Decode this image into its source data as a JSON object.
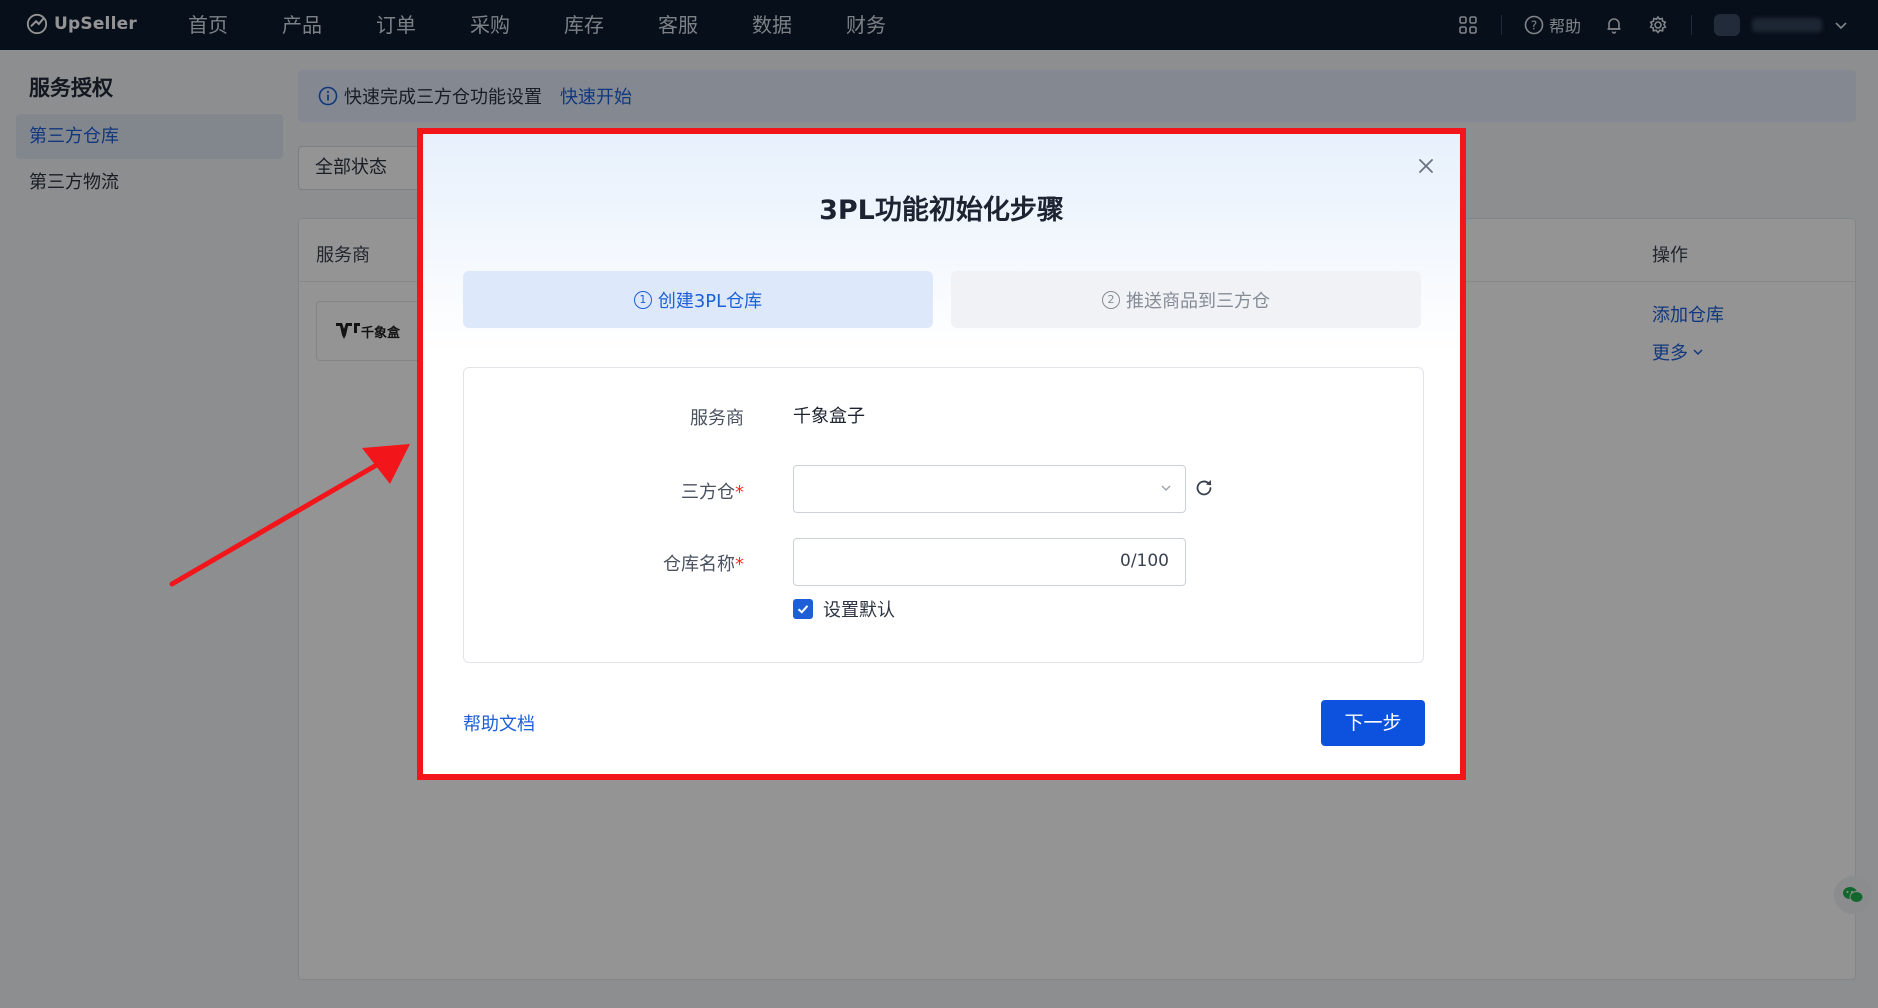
{
  "app": {
    "brand": "UpSeller"
  },
  "nav": {
    "items": [
      "首页",
      "产品",
      "订单",
      "采购",
      "库存",
      "客服",
      "数据",
      "财务"
    ],
    "help_label": "帮助"
  },
  "sidebar": {
    "title": "服务授权",
    "items": [
      {
        "label": "第三方仓库",
        "active": true
      },
      {
        "label": "第三方物流",
        "active": false
      }
    ]
  },
  "banner": {
    "text": "快速完成三方仓功能设置",
    "link": "快速开始"
  },
  "filter": {
    "status_value": "全部状态"
  },
  "table": {
    "headers": {
      "provider": "服务商",
      "operations": "操作"
    },
    "row": {
      "provider_logo_text": "千象盒",
      "add_link": "添加仓库",
      "more_link": "更多"
    }
  },
  "modal": {
    "title": "3PL功能初始化步骤",
    "steps": [
      {
        "num": "1",
        "label": "创建3PL仓库",
        "active": true
      },
      {
        "num": "2",
        "label": "推送商品到三方仓",
        "active": false
      }
    ],
    "form": {
      "provider_label": "服务商",
      "provider_value": "千象盒子",
      "warehouse_label": "三方仓",
      "warehouse_value": "",
      "name_label": "仓库名称",
      "name_value": "",
      "name_counter": "0/100",
      "default_label": "设置默认",
      "default_checked": true,
      "required_mark": "*"
    },
    "help_link": "帮助文档",
    "next_button": "下一步"
  },
  "colors": {
    "primary": "#1e5fd8",
    "button": "#0d52df",
    "highlight": "#f2151a",
    "topbar": "#0d1a2e"
  }
}
